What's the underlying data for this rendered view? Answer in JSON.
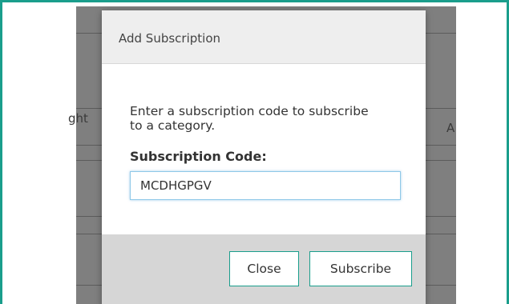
{
  "background": {
    "left_column_fragment": "ght",
    "right_column_fragment": "A"
  },
  "dialog": {
    "title": "Add Subscription",
    "instructions": "Enter a subscription code to subscribe to a category.",
    "code_label": "Subscription Code:",
    "code_value": "MCDHGPGV",
    "close_label": "Close",
    "subscribe_label": "Subscribe"
  },
  "colors": {
    "frame_border": "#1a9e8c",
    "backdrop": "#7f7f7f",
    "header_bg": "#eeeeee",
    "footer_bg": "#d6d6d6",
    "input_focus": "#8ec8e8"
  }
}
